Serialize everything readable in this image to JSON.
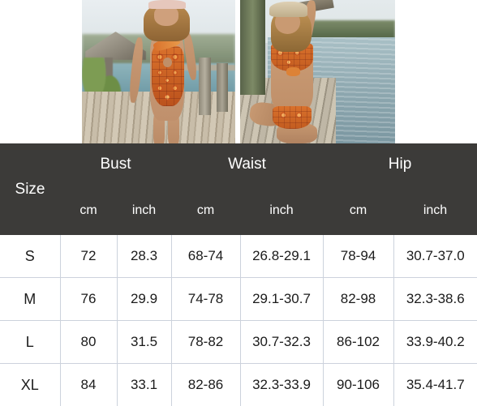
{
  "photos": [
    {
      "name": "swimsuit-one-piece-photo",
      "alt": "Model in orange geometric print one-shoulder one-piece swimsuit standing on a wooden dock"
    },
    {
      "name": "swimsuit-bikini-photo",
      "alt": "Model wearing straw visor and matching orange print bikini seated on a dock by the water"
    }
  ],
  "chart_data": {
    "type": "table",
    "title": "",
    "size_header": "Size",
    "groups": [
      {
        "label": "Bust",
        "units": [
          "cm",
          "inch"
        ]
      },
      {
        "label": "Waist",
        "units": [
          "cm",
          "inch"
        ]
      },
      {
        "label": "Hip",
        "units": [
          "cm",
          "inch"
        ]
      }
    ],
    "columns": [
      "Size",
      "cm",
      "inch",
      "cm",
      "inch",
      "cm",
      "inch"
    ],
    "rows": [
      {
        "size": "S",
        "bust_cm": "72",
        "bust_inch": "28.3",
        "waist_cm": "68-74",
        "waist_inch": "26.8-29.1",
        "hip_cm": "78-94",
        "hip_inch": "30.7-37.0"
      },
      {
        "size": "M",
        "bust_cm": "76",
        "bust_inch": "29.9",
        "waist_cm": "74-78",
        "waist_inch": "29.1-30.7",
        "hip_cm": "82-98",
        "hip_inch": "32.3-38.6"
      },
      {
        "size": "L",
        "bust_cm": "80",
        "bust_inch": "31.5",
        "waist_cm": "78-82",
        "waist_inch": "30.7-32.3",
        "hip_cm": "86-102",
        "hip_inch": "33.9-40.2"
      },
      {
        "size": "XL",
        "bust_cm": "84",
        "bust_inch": "33.1",
        "waist_cm": "82-86",
        "waist_inch": "32.3-33.9",
        "hip_cm": "90-106",
        "hip_inch": "35.4-41.7"
      }
    ]
  },
  "colors": {
    "header_background": "#3c3b39",
    "header_text": "#ffffff",
    "grid_line": "#ccd2dc",
    "cell_text": "#1b1b1b",
    "page_background": "#ffffff",
    "print_accent": "#d9712c"
  }
}
